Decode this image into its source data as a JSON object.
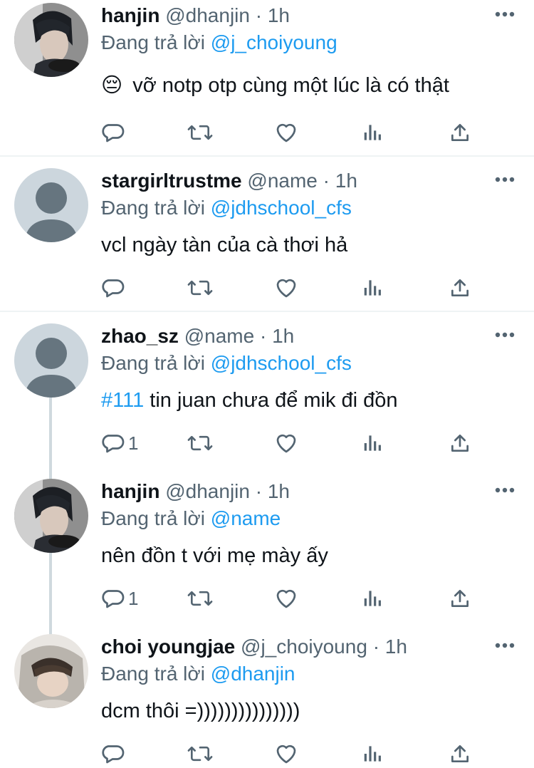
{
  "colors": {
    "link": "#1d9bf0",
    "secondary": "#536471",
    "divider": "#eff3f4",
    "thread": "#cfd9de"
  },
  "tweets": [
    {
      "name": "hanjin",
      "handle": "@dhanjin",
      "sep": "·",
      "time": "1h",
      "reply_prefix": "Đang trả lời",
      "reply_to": "@j_choiyoung",
      "emoji": "😔",
      "text": "vỡ notp otp cùng một lúc là có thật",
      "reply_count": ""
    },
    {
      "name": "stargirltrustme",
      "handle": "@name",
      "sep": "·",
      "time": "1h",
      "reply_prefix": "Đang trả lời",
      "reply_to": "@jdhschool_cfs",
      "text": "vcl ngày tàn của cà thơi hả",
      "reply_count": ""
    },
    {
      "name": "zhao_sz",
      "handle": "@name",
      "sep": "·",
      "time": "1h",
      "reply_prefix": "Đang trả lời",
      "reply_to": "@jdhschool_cfs",
      "hashtag": "#111",
      "text": "tin juan chưa để mik đi đồn",
      "reply_count": "1"
    },
    {
      "name": "hanjin",
      "handle": "@dhanjin",
      "sep": "·",
      "time": "1h",
      "reply_prefix": "Đang trả lời",
      "reply_to": "@name",
      "text": "nên đồn t với mẹ mày ấy",
      "reply_count": "1"
    },
    {
      "name": "choi youngjae",
      "handle": "@j_choiyoung",
      "sep": "·",
      "time": "1h",
      "reply_prefix": "Đang trả lời",
      "reply_to": "@dhanjin",
      "text": "dcm thôi =)))))))))))))))",
      "reply_count": ""
    }
  ],
  "icons": [
    "reply-icon",
    "retweet-icon",
    "like-icon",
    "analytics-icon",
    "share-icon",
    "more-icon"
  ]
}
